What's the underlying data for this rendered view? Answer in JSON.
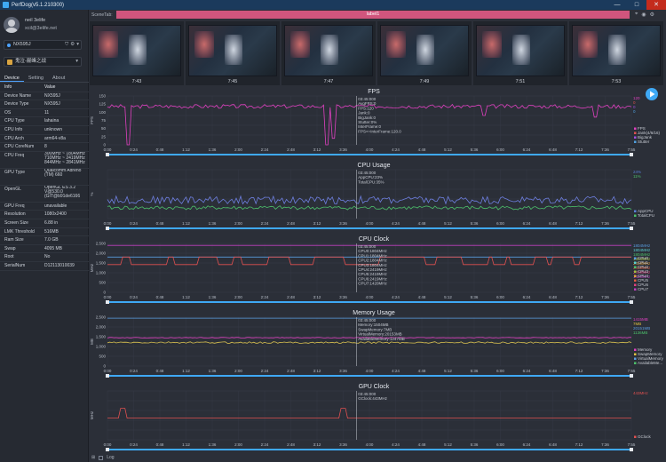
{
  "window": {
    "title": "PerfDog(v5.1.210300)",
    "controls": [
      "—",
      "□",
      "✕"
    ]
  },
  "user": {
    "name": "neil 3elife",
    "email": "xcil@3elife.net"
  },
  "device_select": {
    "value": "NX595J"
  },
  "app_select": {
    "value": "鬼泣-巅峰之战"
  },
  "tabs": [
    "Device",
    "Setting",
    "About"
  ],
  "info": {
    "headers": [
      "Info",
      "Value"
    ],
    "rows": [
      {
        "k": "Device Name",
        "v": "NX595J"
      },
      {
        "k": "Device Type",
        "v": "NX595J"
      },
      {
        "k": "OS",
        "v": "11"
      },
      {
        "k": "CPU Type",
        "v": "lahaina"
      },
      {
        "k": "CPU Info",
        "v": "unknown"
      },
      {
        "k": "CPU Arch",
        "v": "arm64-v8a"
      },
      {
        "k": "CPU CoreNum",
        "v": "8"
      },
      {
        "k": "CPU Freq",
        "v": "300MHz ~ 1804MHz 710MHz ~ 2419MHz 844MHz ~ 2841MHz"
      },
      {
        "k": "GPU Type",
        "v": "Qualcomm Adreno (TM) 660"
      },
      {
        "k": "OpenGL",
        "v": "OpenGL ES 3.2 V@530.0 (GIT@b91de6166"
      },
      {
        "k": "GPU Freq",
        "v": "unavailable"
      },
      {
        "k": "Resolution",
        "v": "1080x2400"
      },
      {
        "k": "Screen Size",
        "v": "6.88 in"
      },
      {
        "k": "LMK Threshold",
        "v": "516MB"
      },
      {
        "k": "Ram Size",
        "v": "7.0 GB"
      },
      {
        "k": "Swap",
        "v": "4095 MB"
      },
      {
        "k": "Root",
        "v": "No"
      },
      {
        "k": "SerialNum",
        "v": "D12113010039"
      }
    ]
  },
  "scene": {
    "label": "SceneTab:",
    "tab": "label1"
  },
  "thumbnails": [
    {
      "time": "7:43"
    },
    {
      "time": "7:45"
    },
    {
      "time": "7:47"
    },
    {
      "time": "7:49"
    },
    {
      "time": "7:51"
    },
    {
      "time": "7:53"
    }
  ],
  "time_ticks": [
    "0:00",
    "0:24",
    "0:48",
    "1:12",
    "1:36",
    "2:00",
    "2:24",
    "2:48",
    "3:12",
    "3:36",
    "4:00",
    "4:24",
    "4:48",
    "5:12",
    "5:36",
    "6:00",
    "6:24",
    "6:48",
    "7:12",
    "7:36",
    "7:55"
  ],
  "chart_data": [
    {
      "type": "line",
      "title": "FPS",
      "ylabel": "FPS",
      "ylim": [
        0,
        150
      ],
      "yticks": [
        "0",
        "25",
        "50",
        "75",
        "100",
        "125",
        "150"
      ],
      "tooltip": [
        "03:45:000",
        "AvgFPS:0",
        "FPS:120",
        "Jank:0",
        "BigJank:0",
        "Stutter:0%",
        "InterFrame:0",
        "FPS<=InterFrame:120.0"
      ],
      "legend": [
        {
          "name": "FPS",
          "value": "120",
          "color": "#e040c0"
        },
        {
          "name": "Jank",
          "value": "0",
          "color": "#e05050"
        },
        {
          "name": "BigJank",
          "value": "0",
          "color": "#a050e0"
        },
        {
          "name": "Stutter",
          "value": "0",
          "color": "#50a0e0"
        }
      ],
      "legend_labels": [
        "FPS",
        "Jank(4/6/16)",
        "BigJank",
        "Stutter"
      ],
      "series": [
        {
          "name": "FPS",
          "color": "#e040c0",
          "base": 118,
          "noise": 6,
          "dips": [
            [
              0.04,
              0
            ],
            [
              0.42,
              0
            ],
            [
              0.43,
              20
            ],
            [
              0.72,
              90
            ],
            [
              0.93,
              85
            ]
          ]
        }
      ]
    },
    {
      "type": "line",
      "title": "CPU Usage",
      "ylabel": "%",
      "ylim": [
        0,
        100
      ],
      "tooltip": [
        "03:45:000",
        "AppCPU:23%",
        "TotalCPU:35%"
      ],
      "legend": [
        {
          "name": "AppCPU",
          "value": "24%",
          "color": "#5a7fd8"
        },
        {
          "name": "TotalCPU",
          "value": "11%",
          "color": "#4cc06a"
        }
      ],
      "series": [
        {
          "name": "AppCPU",
          "color": "#6e7fe0",
          "base": 38,
          "noise": 8
        },
        {
          "name": "TotalCPU",
          "color": "#4cc06a",
          "base": 22,
          "noise": 4
        }
      ]
    },
    {
      "type": "line",
      "title": "CPU Clock",
      "ylabel": "MHz",
      "ylim": [
        0,
        2500
      ],
      "yticks": [
        "0",
        "500",
        "1,000",
        "1,500",
        "2,000",
        "2,500"
      ],
      "tooltip": [
        "03:45:000",
        "CPU0:1804MHz",
        "CPU1:1804MHz",
        "CPU2:1804MHz",
        "CPU3:1804MHz",
        "CPU4:2419MHz",
        "CPU5:2419MHz",
        "CPU6:2419MHz",
        "CPU7:1420MHz"
      ],
      "legend": [
        {
          "name": "CPU0",
          "value": "1804MHz",
          "color": "#5a9de0"
        },
        {
          "name": "CPU1",
          "value": "1804MHz",
          "color": "#5ad0d0"
        },
        {
          "name": "CPU2",
          "value": "1804MHz",
          "color": "#4cc06a"
        },
        {
          "name": "CPU3",
          "value": "1804MHz",
          "color": "#a0c040"
        },
        {
          "name": "CPU4",
          "value": "2419MHz",
          "color": "#e0a040"
        },
        {
          "name": "CPU5",
          "value": "2419MHz",
          "color": "#e06040"
        },
        {
          "name": "CPU6",
          "value": "2419MHz",
          "color": "#e04080"
        },
        {
          "name": "CPU7",
          "value": "1420MHz",
          "color": "#c040c0"
        }
      ],
      "series": [
        {
          "name": "CPU0-3",
          "color": "#5a9de0",
          "base": 1804,
          "noise": 0
        },
        {
          "name": "CPU4-6",
          "color": "#e05050",
          "base": 1700,
          "noise": 0,
          "square": true
        },
        {
          "name": "CPU7",
          "color": "#c040c0",
          "base": 2400,
          "noise": 0
        }
      ]
    },
    {
      "type": "line",
      "title": "Memory Usage",
      "ylabel": "MB",
      "ylim": [
        0,
        2500
      ],
      "yticks": [
        "0",
        "500",
        "1,000",
        "1,500",
        "2,000",
        "2,500"
      ],
      "tooltip": [
        "03:45:000",
        "Memory:1504MB",
        "SwapMemory:7MB",
        "VirtualMemory:20153MB",
        "AvailableMemory:1247MB"
      ],
      "legend": [
        {
          "name": "Memory",
          "value": "1415MB",
          "color": "#e040c0"
        },
        {
          "name": "SwapMemory",
          "value": "7MB",
          "color": "#e0c040"
        },
        {
          "name": "VirtualMemory",
          "value": "20151MB",
          "color": "#5a9de0"
        },
        {
          "name": "AvailableMemory",
          "value": "1136MB",
          "color": "#4cc06a"
        }
      ],
      "legend_labels": [
        "Memory",
        "SwapMemory",
        "VirtualMemory",
        "AvailableMe..."
      ],
      "series": [
        {
          "name": "Memory",
          "color": "#e040c0",
          "base": 1450,
          "noise": 15
        },
        {
          "name": "AvailableMemory",
          "color": "#d8c050",
          "base": 1200,
          "noise": 40
        },
        {
          "name": "VirtualMemory",
          "color": "#5a9de0",
          "base": 2450,
          "noise": 0
        }
      ]
    },
    {
      "type": "line",
      "title": "GPU Clock",
      "ylabel": "MHz",
      "ylim": [
        0,
        1000
      ],
      "tooltip": [
        "03:45:000",
        "GClock:443MHz"
      ],
      "legend": [
        {
          "name": "GClock",
          "value": "443MHz",
          "color": "#e05050"
        }
      ],
      "series": [
        {
          "name": "GClock",
          "color": "#e05050",
          "base": 443,
          "noise": 0,
          "spikes": [
            0.03,
            0.45
          ]
        }
      ]
    }
  ],
  "bottom": {
    "log_label": "Log"
  },
  "colors": {
    "accent": "#4da3ff",
    "scene_tab": "#d0557d",
    "panel": "#262a32",
    "chart_bg": "#2b2f38"
  },
  "icons": [
    "shield-icon",
    "gear-icon",
    "location-icon",
    "camera-icon",
    "play-icon",
    "refresh-icon"
  ]
}
